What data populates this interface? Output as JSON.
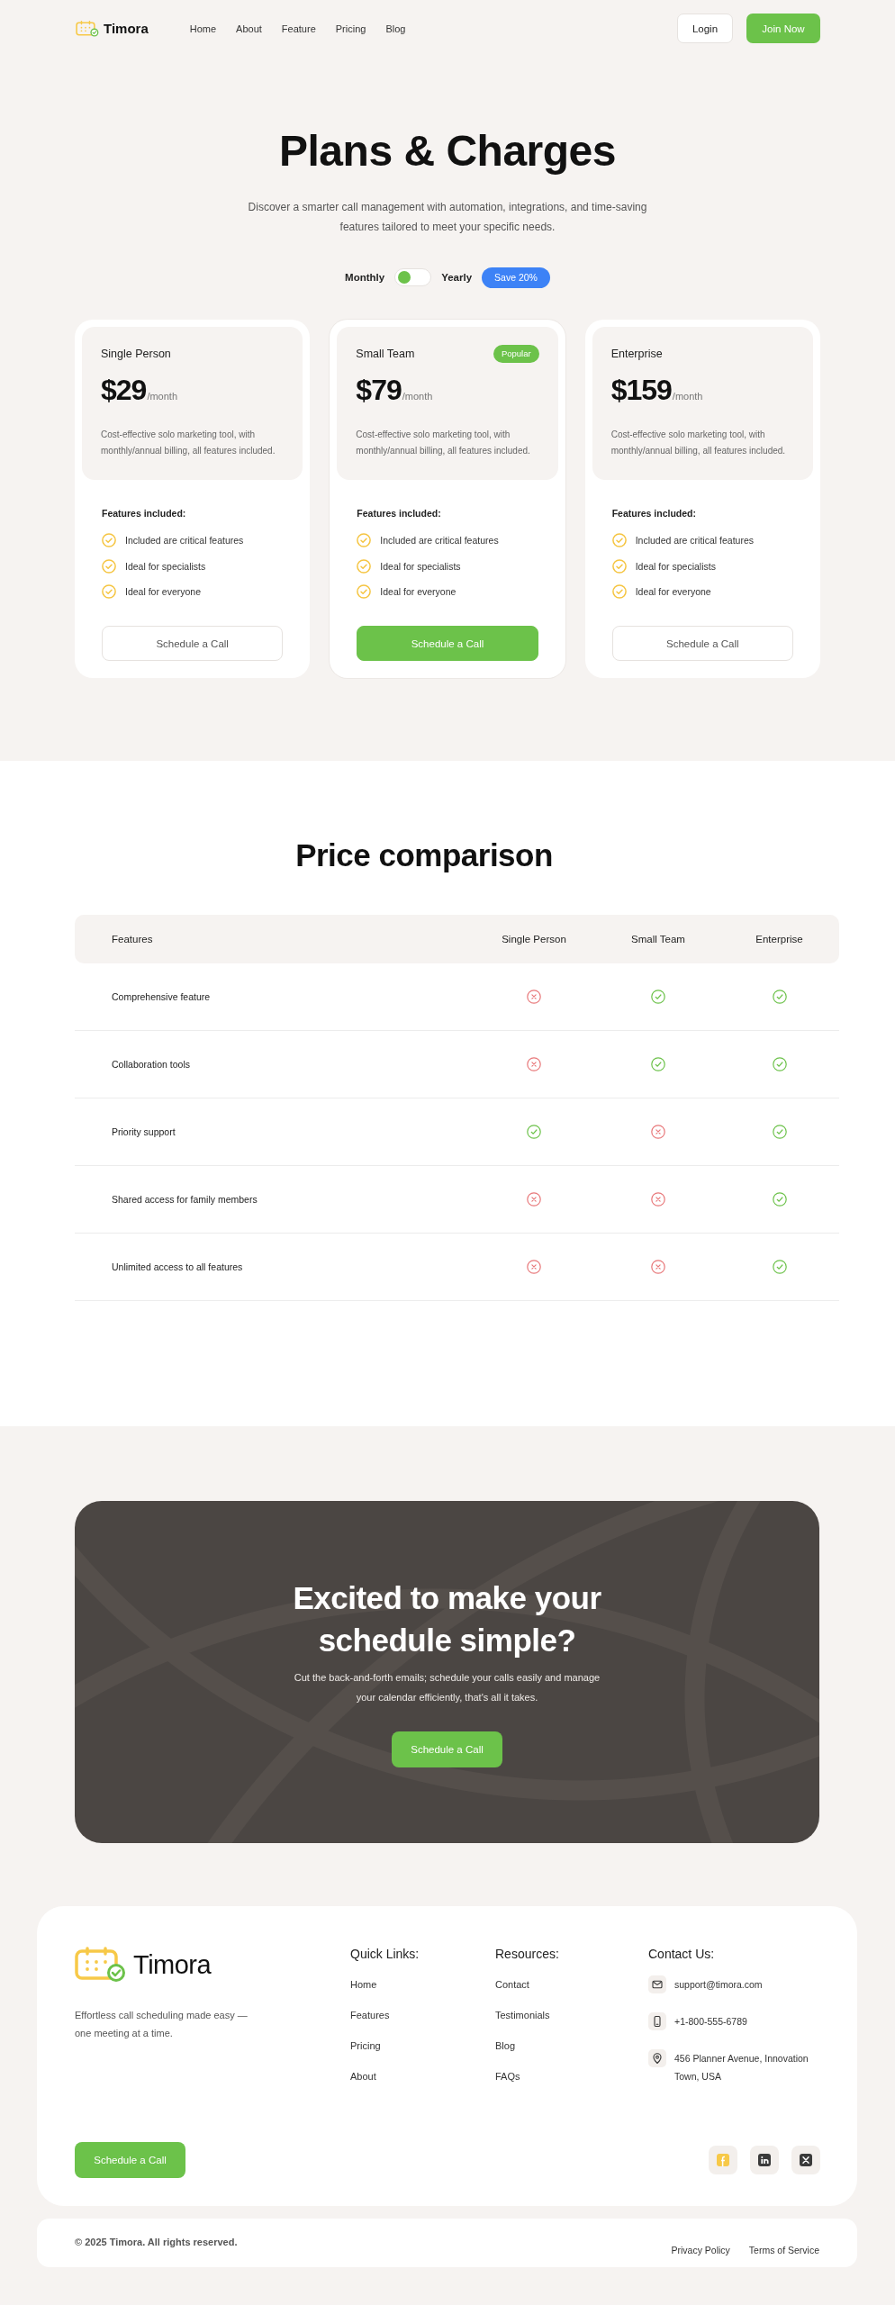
{
  "header": {
    "logo": {
      "name": "Timora"
    },
    "nav": [
      "Home",
      "About",
      "Feature",
      "Pricing",
      "Blog"
    ],
    "buttons": [
      {
        "label": "Login",
        "kind": "secondary"
      },
      {
        "label": "Join Now",
        "kind": "primary"
      }
    ]
  },
  "hero": {
    "title": "Plans & Charges",
    "subtitle": "Discover a smarter call management with automation, integrations, and time-saving features tailored to meet your specific needs.",
    "billing": {
      "labels": [
        "Monthly",
        "Yearly"
      ],
      "on": false,
      "badge": "Save 20%"
    }
  },
  "plans": [
    {
      "name": "Single Person",
      "price": "$29",
      "period": "/month",
      "description": "Cost-effective solo marketing tool, with monthly/annual billing, all features included.",
      "features_heading": "Features included:",
      "features": [
        "Included are critical features",
        "Ideal for specialists",
        "Ideal for everyone"
      ],
      "button": "Schedule a Call",
      "featured": false
    },
    {
      "name": "Small Team",
      "badge": "Popular",
      "price": "$79",
      "period": "/month",
      "description": "Cost-effective solo marketing tool, with monthly/annual billing, all features included.",
      "features_heading": "Features included:",
      "features": [
        "Included are critical features",
        "Ideal for specialists",
        "Ideal for everyone"
      ],
      "button": "Schedule a Call",
      "featured": true
    },
    {
      "name": "Enterprise",
      "price": "$159",
      "period": "/month",
      "description": "Cost-effective solo marketing tool, with monthly/annual billing, all features included.",
      "features_heading": "Features included:",
      "features": [
        "Included are critical features",
        "Ideal for specialists",
        "Ideal for everyone"
      ],
      "button": "Schedule a Call",
      "featured": false
    }
  ],
  "comparison": {
    "title": "Price comparison",
    "columns": [
      "Features",
      "Single Person",
      "Small Team",
      "Enterprise"
    ],
    "rows": [
      {
        "feature": "Comprehensive feature",
        "included": [
          false,
          true,
          true
        ]
      },
      {
        "feature": "Collaboration tools",
        "included": [
          false,
          true,
          true
        ]
      },
      {
        "feature": "Priority support",
        "included": [
          true,
          false,
          true
        ]
      },
      {
        "feature": "Shared access for family members",
        "included": [
          false,
          false,
          true
        ]
      },
      {
        "feature": "Unlimited access to all features",
        "included": [
          false,
          false,
          true
        ]
      }
    ]
  },
  "cta": {
    "title": "Excited to make your schedule simple?",
    "text": "Cut the back-and-forth emails; schedule your calls easily and manage your calendar efficiently, that's all it takes.",
    "button": "Schedule a Call"
  },
  "footer": {
    "logo": {
      "name": "Timora"
    },
    "tagline": "Effortless call scheduling made easy — one meeting at a time.",
    "columns": [
      {
        "heading": "Quick Links:",
        "links": [
          "Home",
          "Features",
          "Pricing",
          "About"
        ]
      },
      {
        "heading": "Resources:",
        "links": [
          "Contact",
          "Testimonials",
          "Blog",
          "FAQs"
        ]
      }
    ],
    "contact": {
      "heading": "Contact Us:",
      "items": [
        {
          "kind": "email",
          "text": "support@timora.com"
        },
        {
          "kind": "phone",
          "text": "+1-800-555-6789"
        },
        {
          "kind": "location",
          "text": "456 Planner Avenue, Innovation Town, USA"
        }
      ]
    },
    "button": "Schedule a Call",
    "socials": [
      {
        "kind": "facebook",
        "color": "#f7c948"
      },
      {
        "kind": "linkedin",
        "color": "#3a3a3a"
      },
      {
        "kind": "x",
        "color": "#3a3a3a"
      }
    ]
  },
  "bottom_bar": {
    "copyright": "© 2025 Timora. All rights reserved.",
    "links": [
      "Privacy Policy",
      "Terms of Service"
    ]
  }
}
